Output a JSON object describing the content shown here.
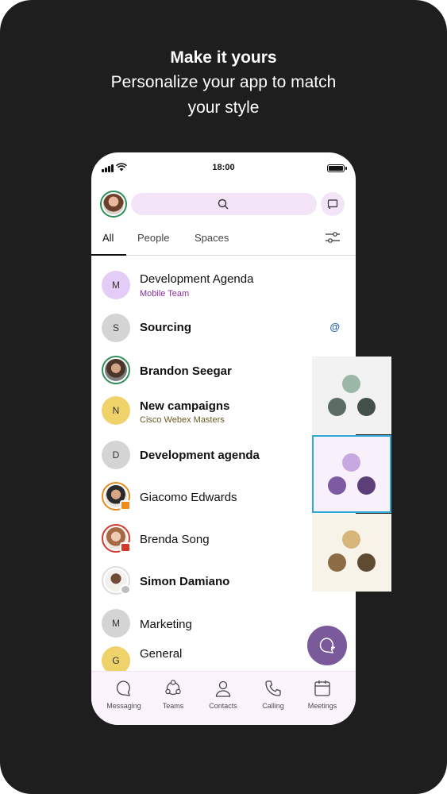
{
  "promo": {
    "title": "Make it yours",
    "subtitle": "Personalize your app to match your style"
  },
  "status_bar": {
    "time": "18:00"
  },
  "search": {
    "icon": "search-icon"
  },
  "tabs": [
    {
      "label": "All",
      "active": true
    },
    {
      "label": "People",
      "active": false
    },
    {
      "label": "Spaces",
      "active": false
    }
  ],
  "conversations": [
    {
      "title": "Development Agenda",
      "subtitle": "Mobile Team",
      "initial": "M",
      "bold": false
    },
    {
      "title": "Sourcing",
      "initial": "S",
      "bold": true,
      "indicator": "@"
    },
    {
      "title": "Brandon Seegar",
      "bold": true
    },
    {
      "title": "New campaigns",
      "subtitle": "Cisco Webex Masters",
      "initial": "N",
      "bold": true
    },
    {
      "title": "Development agenda",
      "initial": "D",
      "bold": true
    },
    {
      "title": "Giacomo Edwards",
      "bold": false
    },
    {
      "title": "Brenda Song",
      "bold": false
    },
    {
      "title": "Simon Damiano",
      "bold": true
    },
    {
      "title": "Marketing",
      "initial": "M",
      "bold": false
    },
    {
      "title": "General",
      "initial": "G",
      "bold": false
    }
  ],
  "bottom_nav": [
    {
      "label": "Messaging",
      "icon": "messaging-icon"
    },
    {
      "label": "Teams",
      "icon": "teams-icon"
    },
    {
      "label": "Contacts",
      "icon": "contacts-icon"
    },
    {
      "label": "Calling",
      "icon": "calling-icon"
    },
    {
      "label": "Meetings",
      "icon": "meetings-icon"
    }
  ],
  "colors": {
    "accent": "#7a5a9b",
    "search_bg": "#f3e5f7",
    "presence_green": "#2d8f5a",
    "theme_selected_outline": "#30a7d9"
  },
  "themes": [
    {
      "name": "green",
      "background": "#f2f2f2",
      "top": "#9bb8a7",
      "left": "#5b6d62",
      "right": "#44504a",
      "selected": false
    },
    {
      "name": "purple",
      "background": "#f8f1fb",
      "top": "#c8a9df",
      "left": "#7e5aa3",
      "right": "#5c3f78",
      "selected": true
    },
    {
      "name": "gold",
      "background": "#f8f3e9",
      "top": "#d8b57a",
      "left": "#8c6c45",
      "right": "#5f4a32",
      "selected": false
    }
  ]
}
